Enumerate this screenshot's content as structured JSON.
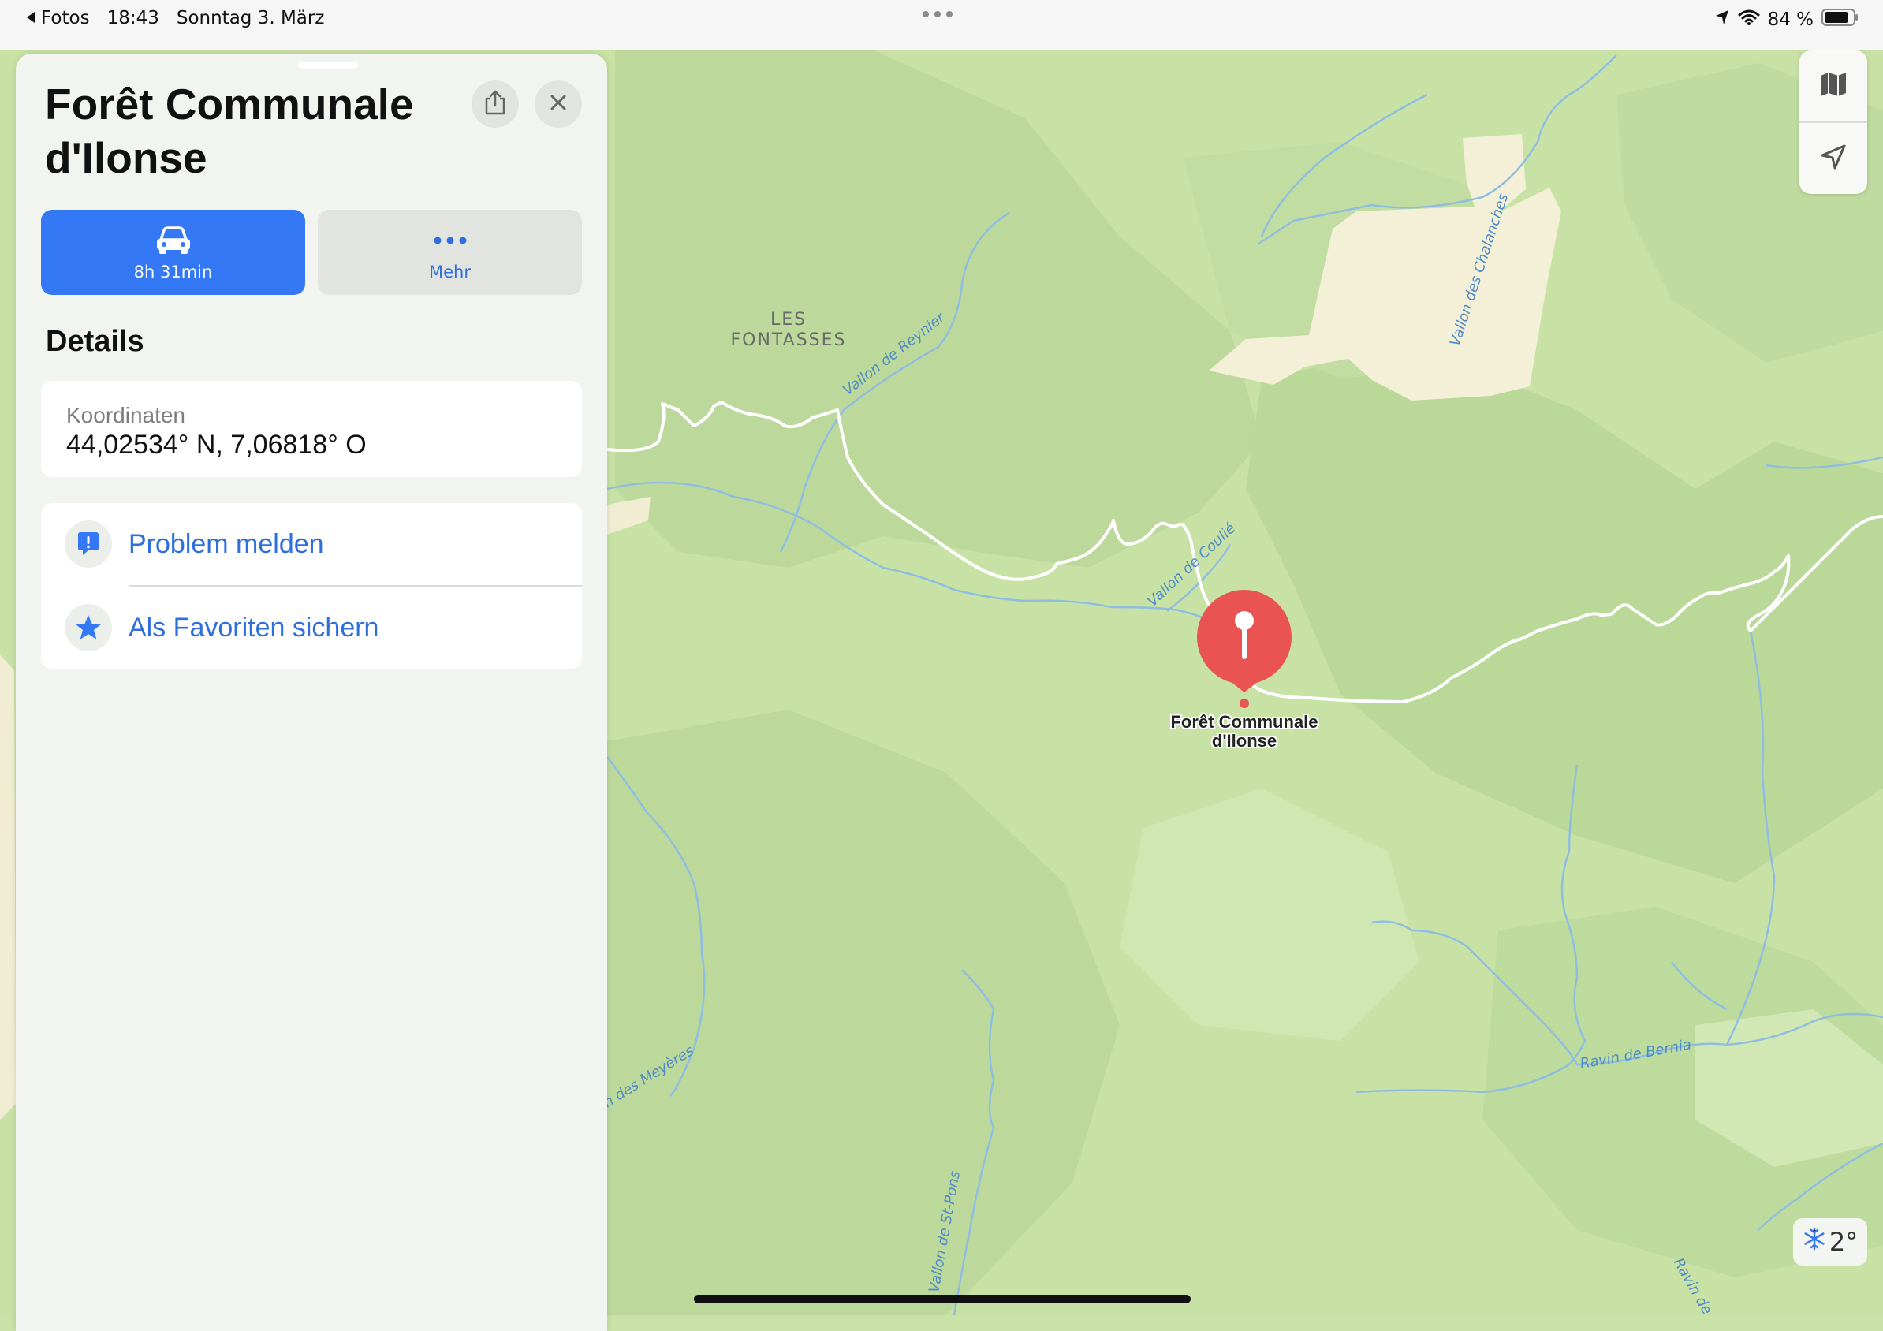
{
  "status_bar": {
    "back_app": "Fotos",
    "time": "18:43",
    "date": "Sonntag 3. März",
    "battery": "84 %",
    "icons": [
      "location-arrow-icon",
      "wifi-icon",
      "battery-icon"
    ]
  },
  "panel": {
    "title": "Forêt Communale d'Ilonse",
    "drive_label": "8h 31min",
    "more_label": "Mehr",
    "details_heading": "Details",
    "coordinates_label": "Koordinaten",
    "coordinates_value": "44,02534° N, 7,06818° O",
    "report_label": "Problem melden",
    "favorite_label": "Als Favoriten sichern"
  },
  "map": {
    "place_name_line1": "LES",
    "place_name_line2": "FONTASSES",
    "pin_label_line1": "Forêt Communale",
    "pin_label_line2": "d'Ilonse",
    "streams": {
      "reynier": "Vallon de Reynier",
      "chalanches": "Vallon des Chalanches",
      "coulie": "Vallon de Coulié",
      "meyeres": "n des Meyères",
      "st_pons": "Vallon de St-Pons",
      "bernia": "Ravin de Bernia",
      "ravin_edge": "Ravin de"
    }
  },
  "weather": {
    "temperature": "2°",
    "icon": "snowflake-icon"
  },
  "colors": {
    "accent": "#3478f6",
    "pin": "#e95452",
    "map_light": "#cfe6b1",
    "map_dark": "#bad898",
    "clearing": "#f4f0d8",
    "water": "#84b6de"
  }
}
